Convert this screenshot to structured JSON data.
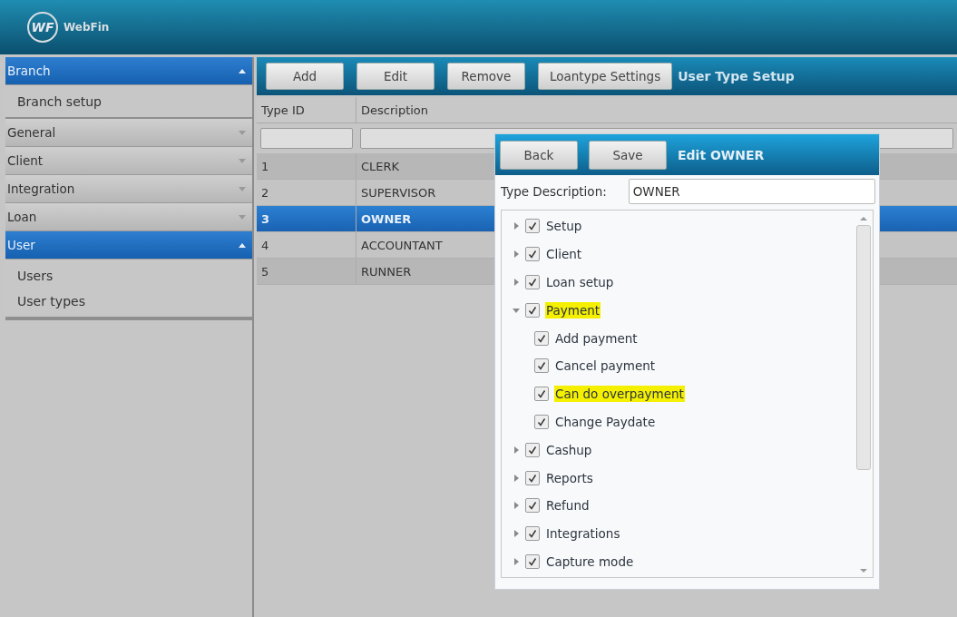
{
  "header": {
    "logo_mark": "WF",
    "app_name": "WebFin"
  },
  "sidebar": {
    "sections": [
      {
        "label": "Branch",
        "expanded": true,
        "items": [
          "Branch setup"
        ]
      },
      {
        "label": "General",
        "expanded": false
      },
      {
        "label": "Client",
        "expanded": false
      },
      {
        "label": "Integration",
        "expanded": false
      },
      {
        "label": "Loan",
        "expanded": false
      },
      {
        "label": "User",
        "expanded": true,
        "items": [
          "Users",
          "User types"
        ]
      }
    ]
  },
  "toolbar": {
    "buttons": [
      "Add",
      "Edit",
      "Remove",
      "Loantype Settings"
    ],
    "title": "User Type Setup"
  },
  "table": {
    "columns": [
      "Type ID",
      "Description"
    ],
    "rows": [
      {
        "cells": [
          "1",
          "CLERK"
        ],
        "selected": false
      },
      {
        "cells": [
          "2",
          "SUPERVISOR"
        ],
        "selected": false
      },
      {
        "cells": [
          "3",
          "OWNER"
        ],
        "selected": true
      },
      {
        "cells": [
          "4",
          "ACCOUNTANT"
        ],
        "selected": false
      },
      {
        "cells": [
          "5",
          "RUNNER"
        ],
        "selected": false
      }
    ]
  },
  "dialog": {
    "buttons": [
      "Back",
      "Save"
    ],
    "title": "Edit OWNER",
    "field_label": "Type Description:",
    "field_value": "OWNER",
    "tree": [
      {
        "label": "Setup",
        "checked": true,
        "expanded": false,
        "highlighted": false
      },
      {
        "label": "Client",
        "checked": true,
        "expanded": false,
        "highlighted": false
      },
      {
        "label": "Loan setup",
        "checked": true,
        "expanded": false,
        "highlighted": false
      },
      {
        "label": "Payment",
        "checked": true,
        "expanded": true,
        "highlighted": true,
        "children": [
          {
            "label": "Add payment",
            "checked": true,
            "highlighted": false
          },
          {
            "label": "Cancel payment",
            "checked": true,
            "highlighted": false
          },
          {
            "label": "Can do overpayment",
            "checked": true,
            "highlighted": true
          },
          {
            "label": "Change Paydate",
            "checked": true,
            "highlighted": false
          }
        ]
      },
      {
        "label": "Cashup",
        "checked": true,
        "expanded": false,
        "highlighted": false
      },
      {
        "label": "Reports",
        "checked": true,
        "expanded": false,
        "highlighted": false
      },
      {
        "label": "Refund",
        "checked": true,
        "expanded": false,
        "highlighted": false
      },
      {
        "label": "Integrations",
        "checked": true,
        "expanded": false,
        "highlighted": false
      },
      {
        "label": "Capture mode",
        "checked": true,
        "expanded": false,
        "highlighted": false
      }
    ]
  }
}
